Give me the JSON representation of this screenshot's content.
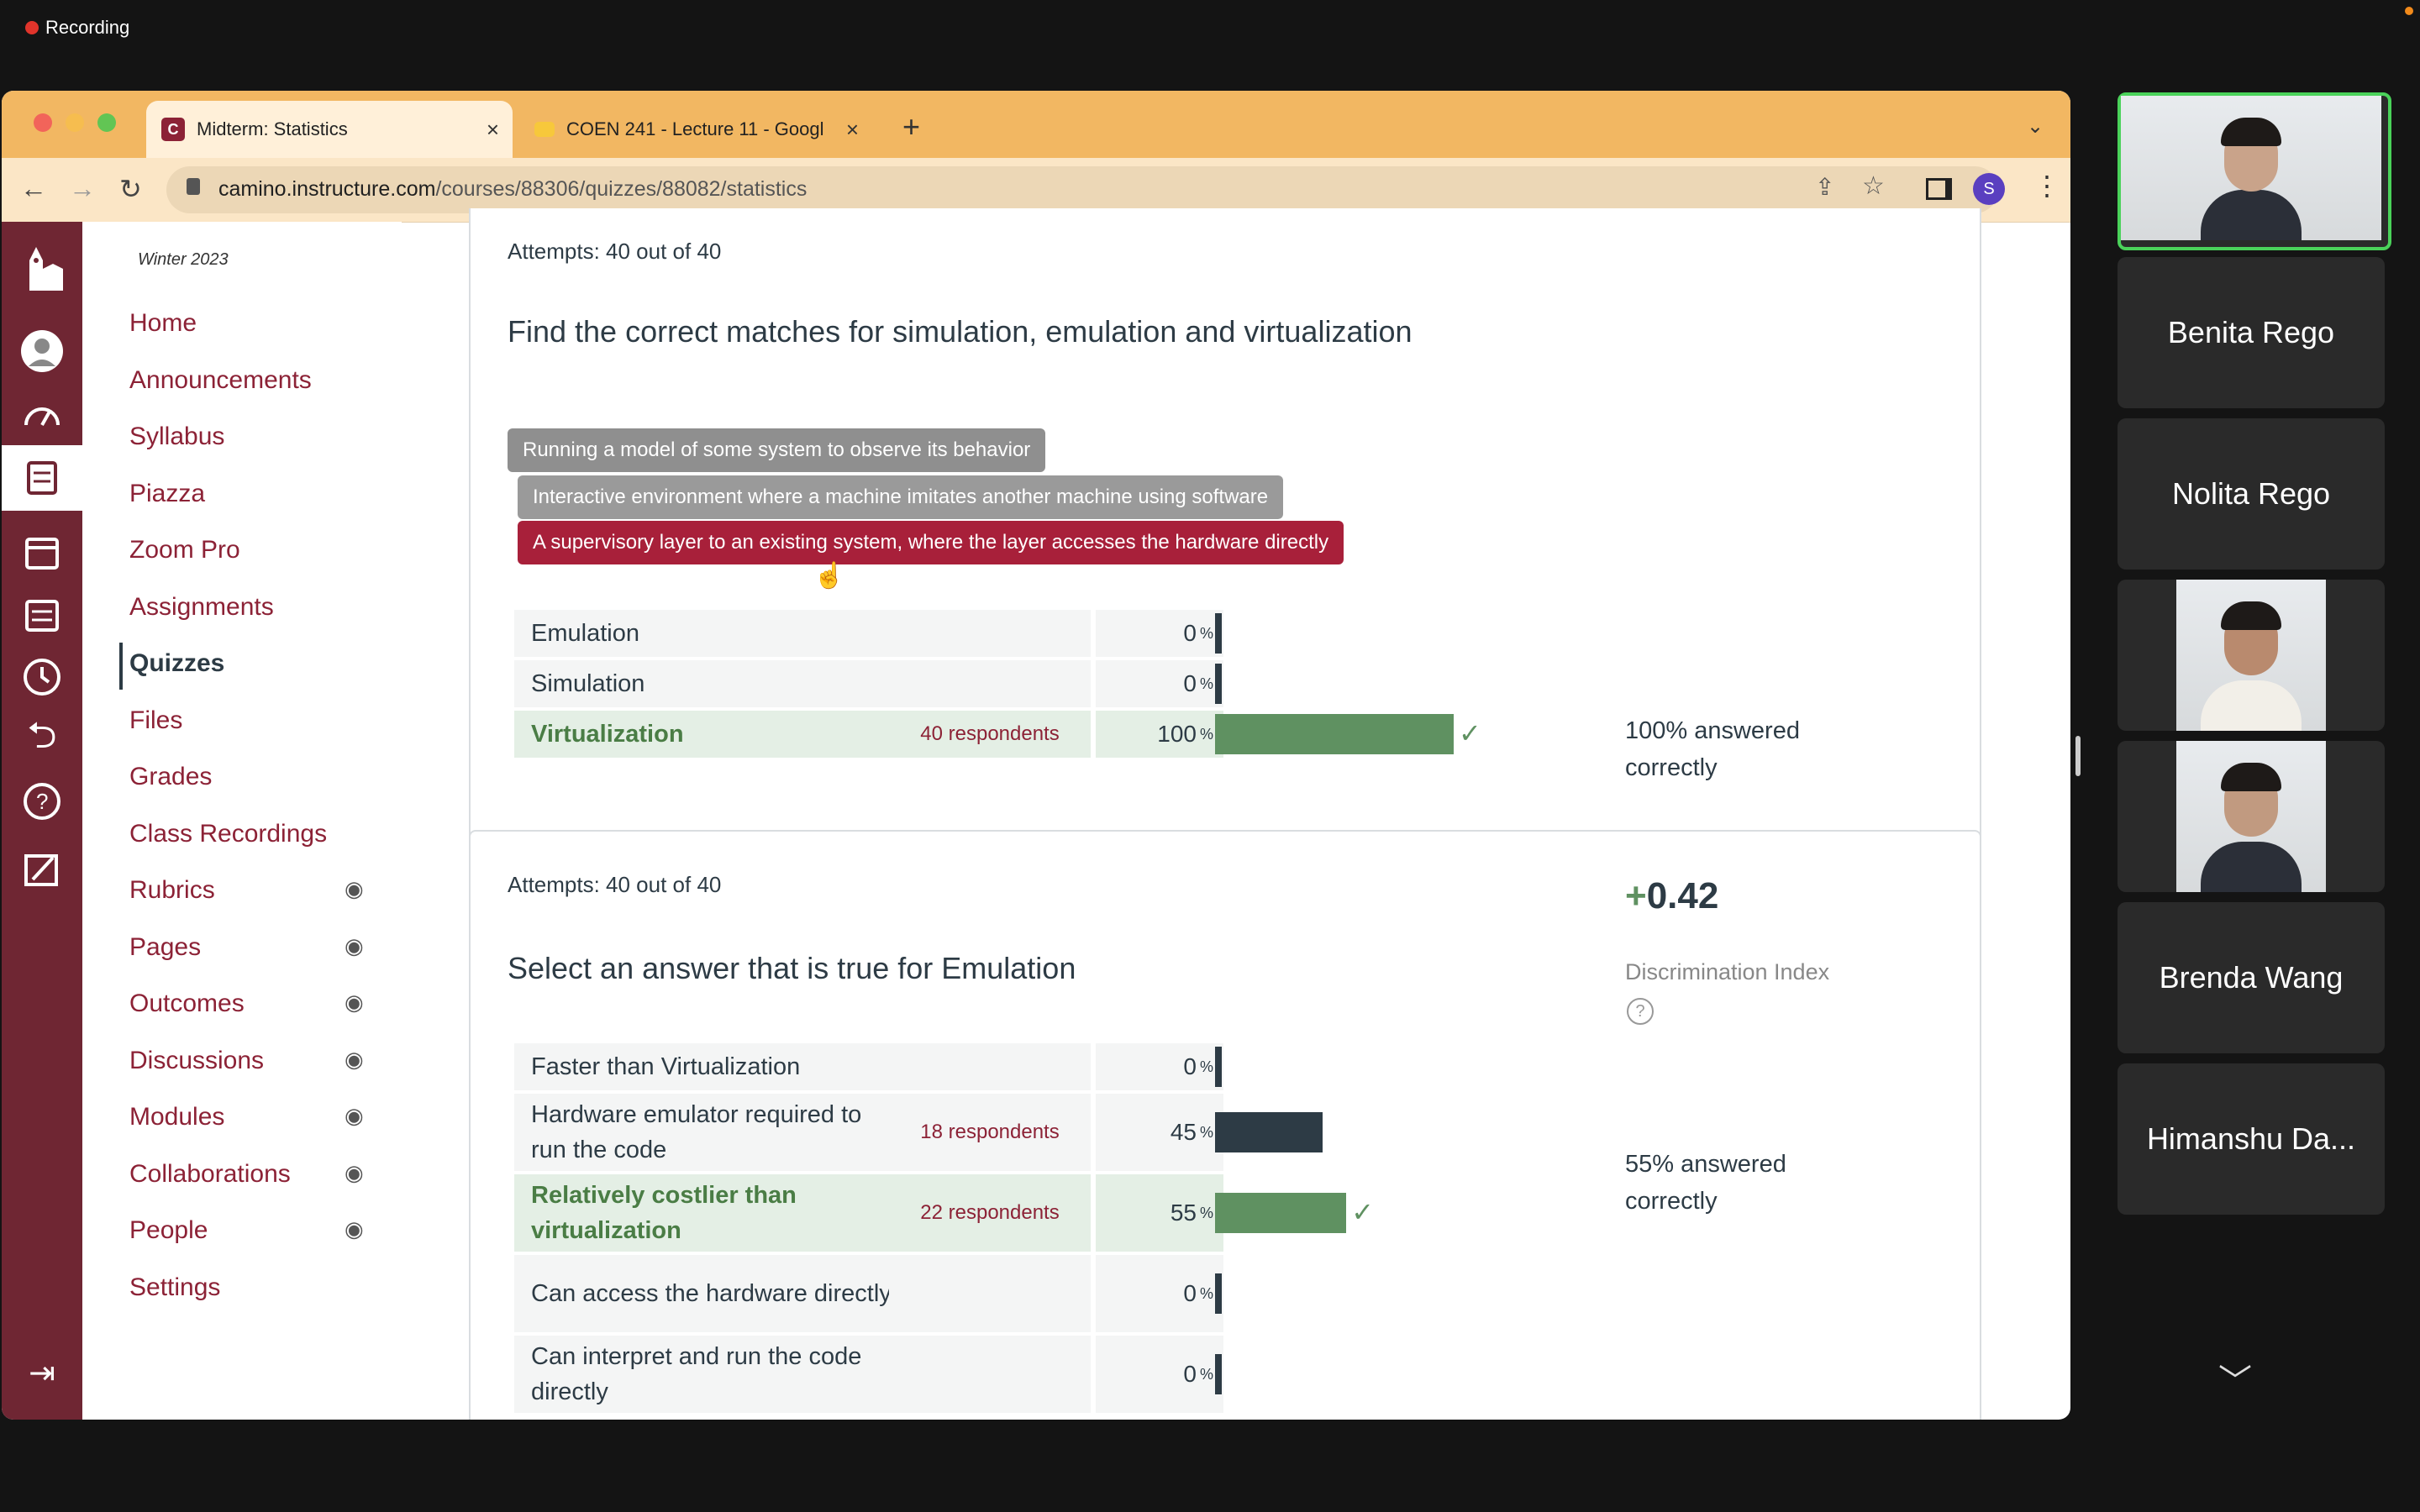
{
  "recording": {
    "label": "Recording"
  },
  "browser": {
    "tabs": [
      {
        "title": "Midterm: Statistics",
        "icon": "canvas-icon"
      },
      {
        "title": "COEN 241 - Lecture 11 - Googl",
        "icon": "slides-icon"
      }
    ],
    "url_host": "camino.instructure.com",
    "url_path": "/courses/88306/quizzes/88082/statistics",
    "profile_initial": "S"
  },
  "course_nav": {
    "term": "Winter 2023",
    "items": [
      {
        "label": "Home",
        "hidden": false
      },
      {
        "label": "Announcements",
        "hidden": false
      },
      {
        "label": "Syllabus",
        "hidden": false
      },
      {
        "label": "Piazza",
        "hidden": false
      },
      {
        "label": "Zoom Pro",
        "hidden": false
      },
      {
        "label": "Assignments",
        "hidden": false
      },
      {
        "label": "Quizzes",
        "hidden": false,
        "current": true
      },
      {
        "label": "Files",
        "hidden": false
      },
      {
        "label": "Grades",
        "hidden": false
      },
      {
        "label": "Class Recordings",
        "hidden": false
      },
      {
        "label": "Rubrics",
        "hidden": true
      },
      {
        "label": "Pages",
        "hidden": true
      },
      {
        "label": "Outcomes",
        "hidden": true
      },
      {
        "label": "Discussions",
        "hidden": true
      },
      {
        "label": "Modules",
        "hidden": true
      },
      {
        "label": "Collaborations",
        "hidden": true
      },
      {
        "label": "People",
        "hidden": true
      },
      {
        "label": "Settings",
        "hidden": false
      }
    ]
  },
  "q1": {
    "attempts": "Attempts: 40 out of 40",
    "question": "Find the correct matches for simulation, emulation and virtualization",
    "chips": [
      "Running a model of some system to observe its behavior",
      "Interactive environment where a machine imitates another machine using software",
      "A supervisory layer to an existing system, where the layer accesses the hardware directly"
    ],
    "rows": [
      {
        "label": "Emulation",
        "respondents": "",
        "pct": "0",
        "value": 0,
        "correct": false
      },
      {
        "label": "Simulation",
        "respondents": "",
        "pct": "0",
        "value": 0,
        "correct": false
      },
      {
        "label": "Virtualization",
        "respondents": "40 respondents",
        "pct": "100",
        "value": 100,
        "correct": true
      }
    ],
    "answered": [
      "100% answered",
      "correctly"
    ]
  },
  "q2": {
    "attempts": "Attempts: 40 out of 40",
    "question": "Select an answer that is true for Emulation",
    "disc_sign": "+",
    "disc_value": "0.42",
    "disc_label": "Discrimination Index",
    "rows": [
      {
        "label": "Faster than Virtualization",
        "respondents": "",
        "pct": "0",
        "value": 0,
        "correct": false
      },
      {
        "label": "Hardware emulator required to run the code",
        "respondents": "18 respondents",
        "pct": "45",
        "value": 45,
        "correct": false
      },
      {
        "label": "Relatively costlier than virtualization",
        "respondents": "22 respondents",
        "pct": "55",
        "value": 55,
        "correct": true
      },
      {
        "label": "Can access the hardware directly",
        "respondents": "",
        "pct": "0",
        "value": 0,
        "correct": false
      },
      {
        "label": "Can interpret and run the code directly",
        "respondents": "",
        "pct": "0",
        "value": 0,
        "correct": false
      }
    ],
    "answered": [
      "55% answered",
      "correctly"
    ]
  },
  "zoom": {
    "participants": [
      {
        "name": "",
        "video": true,
        "active": true
      },
      {
        "name": "Benita Rego",
        "video": false
      },
      {
        "name": "Nolita Rego",
        "video": false
      },
      {
        "name": "",
        "video": true
      },
      {
        "name": "",
        "video": true
      },
      {
        "name": "Brenda Wang",
        "video": false
      },
      {
        "name": "Himanshu Da...",
        "video": false
      }
    ]
  },
  "colors": {
    "canvas_red": "#8c2236",
    "nav_bg": "#6f2633",
    "correct_green": "#5f9161",
    "bar_dark": "#2d3b45",
    "chrome_orange": "#f2b762"
  }
}
